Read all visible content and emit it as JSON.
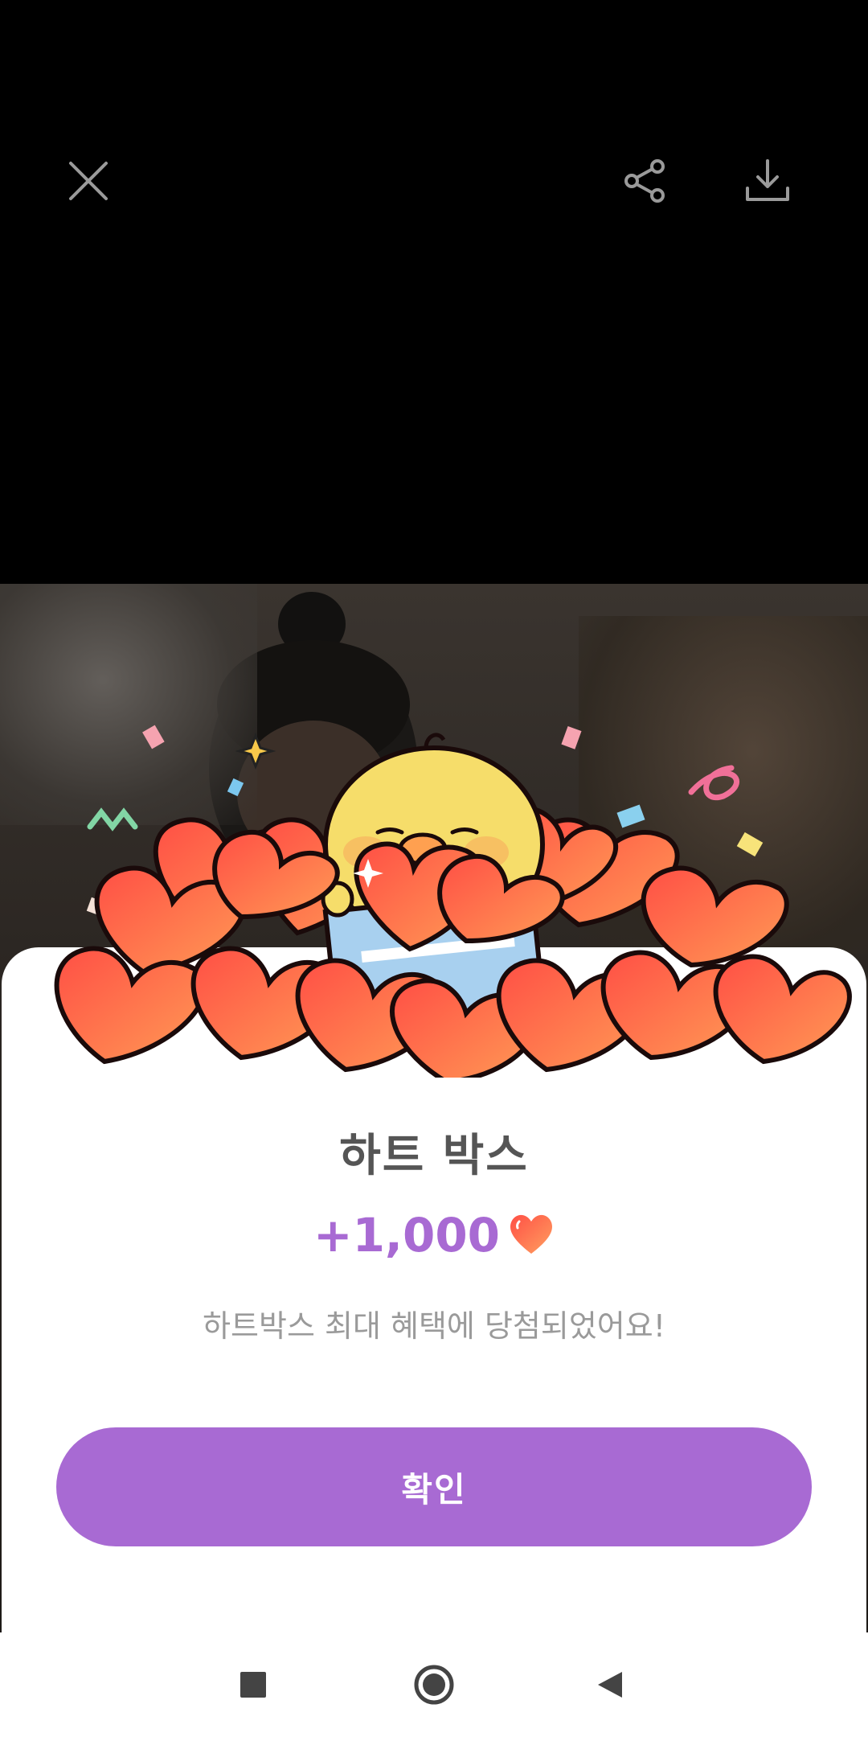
{
  "toolbar": {
    "close_icon": "close-icon",
    "share_icon": "share-icon",
    "download_icon": "download-icon"
  },
  "dialog": {
    "title": "하트 박스",
    "reward_amount": "+1,000",
    "reward_icon": "heart-icon",
    "description": "하트박스 최대 혜택에 당첨되었어요!",
    "confirm_label": "확인"
  },
  "colors": {
    "accent": "#a86ad3",
    "heart": "#ff6a3d",
    "title_text": "#555555",
    "description_text": "#9a9a9a"
  },
  "nav": {
    "recents_icon": "square-icon",
    "home_icon": "circle-icon",
    "back_icon": "triangle-back-icon"
  }
}
